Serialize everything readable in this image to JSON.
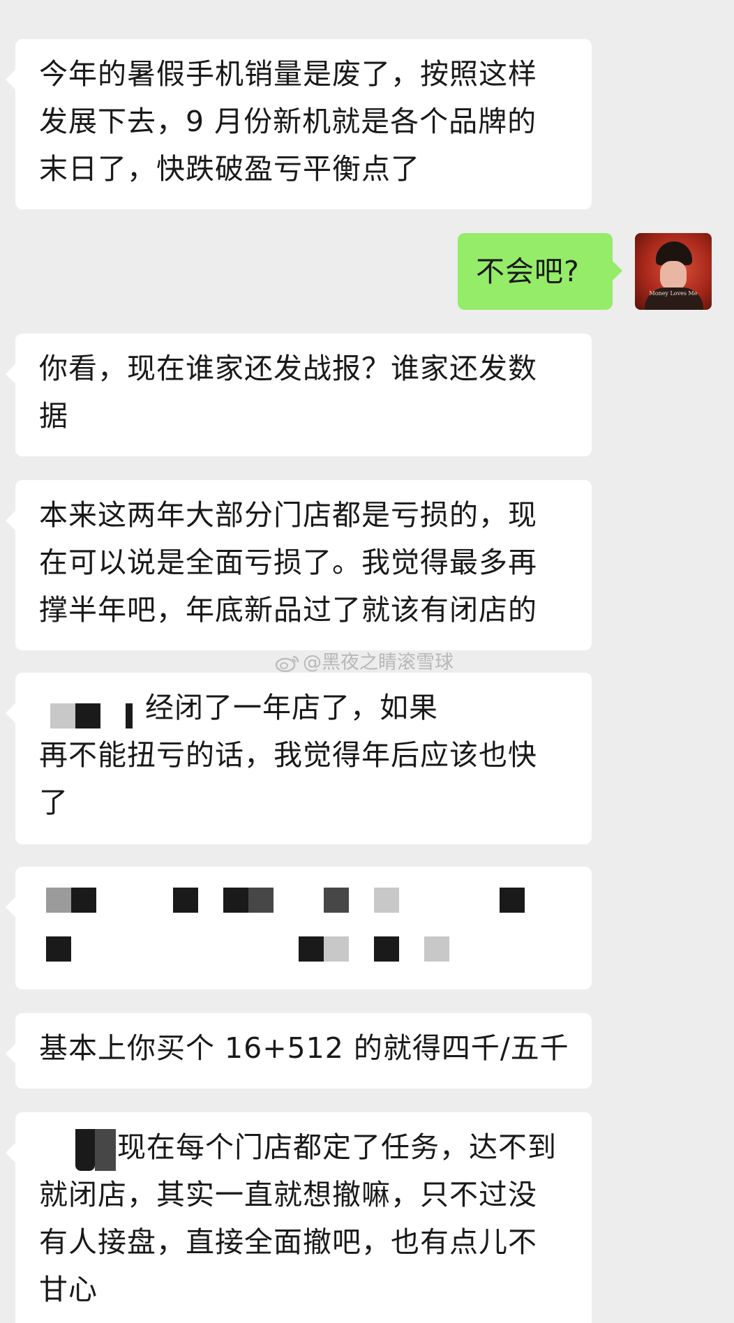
{
  "messages": [
    {
      "lines": [
        "今年的暑假手机销量是废了，按照这样",
        "发展下去，9 月份新机就是各个品牌的",
        "末日了，快跌破盈亏平衡点了"
      ]
    },
    {
      "text": "不会吧?"
    },
    {
      "lines": [
        "你看，现在谁家还发战报？谁家还发数",
        "据"
      ]
    },
    {
      "lines": [
        "本来这两年大部分门店都是亏损的，现",
        "在可以说是全面亏损了。我觉得最多再",
        "撑半年吧，年底新品过了就该有闭店的"
      ]
    },
    {
      "lines": [
        "经闭了一年店了，如果",
        "再不能扭亏的话，我觉得年后应该也快",
        "了"
      ]
    },
    {
      "lines": [
        "基本上你买个 16+512 的就得四千/五千"
      ]
    },
    {
      "lines": [
        "现在每个门店都定了任务，达不到",
        "就闭店，其实一直就想撤嘛，只不过没",
        "有人接盘，直接全面撤吧，也有点儿不",
        "甘心"
      ]
    }
  ],
  "avatar": {
    "caption": "Money Loves Me",
    "icon": "profile-photo"
  },
  "watermark": {
    "text": "@黑夜之睛滚雪球",
    "icon": "weibo-logo"
  },
  "colors": {
    "background": "#ededed",
    "incoming": "#ffffff",
    "outgoing": "#95ec69"
  }
}
